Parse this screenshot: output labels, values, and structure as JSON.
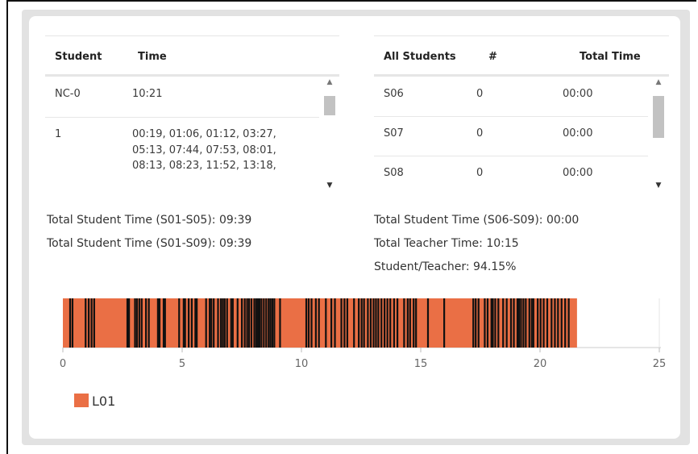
{
  "colors": {
    "bar": "#ea6f45",
    "event": "#111111",
    "panel_bg": "#e2e2e2"
  },
  "left_table": {
    "headers": {
      "student": "Student",
      "time": "Time"
    },
    "rows": [
      {
        "student": "NC-0",
        "times": "10:21"
      },
      {
        "student": "1",
        "times_lines": [
          "00:19, 01:06, 01:12, 03:27,",
          "05:13, 07:44, 07:53, 08:01,",
          "08:13, 08:23, 11:52, 13:18,"
        ]
      }
    ],
    "scrollbar_icons": {
      "up": "caret-up-icon",
      "down": "caret-down-icon"
    }
  },
  "right_table": {
    "headers": {
      "students": "All Students",
      "count": "#",
      "total": "Total Time"
    },
    "rows": [
      {
        "student": "S06",
        "count": "0",
        "total": "00:00"
      },
      {
        "student": "S07",
        "count": "0",
        "total": "00:00"
      },
      {
        "student": "S08",
        "count": "0",
        "total": "00:00"
      }
    ]
  },
  "summary_left": [
    "Total Student Time (S01-S05): 09:39",
    "Total Student Time (S01-S09): 09:39"
  ],
  "summary_right": [
    "Total Student Time (S06-S09): 00:00",
    "Total Teacher Time: 10:15",
    "Student/Teacher: 94.15%"
  ],
  "chart_data": {
    "type": "bar",
    "orientation": "horizontal",
    "xlim": [
      0,
      25
    ],
    "xticks": [
      "0",
      "5",
      "10",
      "15",
      "20",
      "25"
    ],
    "series": [
      {
        "name": "L01",
        "start": 0,
        "end": 21.55
      }
    ],
    "events": [
      0.3,
      0.4,
      0.95,
      1.08,
      1.2,
      1.31,
      2.7,
      2.77,
      3.02,
      3.1,
      3.2,
      3.3,
      3.48,
      3.6,
      3.98,
      4.05,
      4.22,
      4.28,
      4.87,
      5.06,
      5.12,
      5.27,
      5.4,
      5.55,
      5.61,
      6.0,
      6.15,
      6.22,
      6.32,
      6.5,
      6.62,
      6.7,
      6.78,
      6.88,
      7.05,
      7.12,
      7.32,
      7.5,
      7.62,
      7.72,
      7.8,
      7.9,
      8.02,
      8.1,
      8.17,
      8.24,
      8.32,
      8.42,
      8.52,
      8.62,
      8.7,
      8.78,
      8.86,
      9.1,
      10.2,
      10.3,
      10.42,
      10.6,
      10.73,
      11.02,
      11.25,
      11.4,
      11.67,
      11.8,
      11.92,
      12.2,
      12.4,
      12.52,
      12.62,
      12.78,
      12.9,
      13.02,
      13.12,
      13.22,
      13.35,
      13.48,
      13.6,
      13.72,
      13.88,
      14.02,
      14.3,
      14.45,
      14.55,
      14.7,
      14.8,
      15.3,
      15.98,
      17.2,
      17.3,
      17.42,
      17.68,
      17.8,
      17.96,
      18.02,
      18.12,
      18.25,
      18.45,
      18.6,
      18.78,
      18.9,
      19.05,
      19.12,
      19.2,
      19.3,
      19.4,
      19.55,
      19.65,
      19.72,
      19.9,
      20.02,
      20.15,
      20.3,
      20.48,
      20.62,
      20.75,
      20.9,
      21.05,
      21.2
    ],
    "legend": [
      "L01"
    ]
  }
}
